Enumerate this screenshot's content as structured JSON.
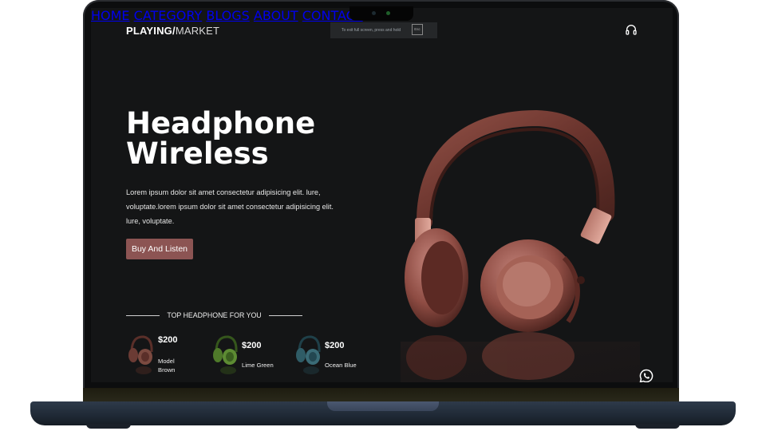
{
  "brand": {
    "logo_bold": "PLAYING/",
    "logo_light": "MARKET"
  },
  "nav": {
    "items": [
      {
        "label": "HOME"
      },
      {
        "label": "CATEGORY"
      },
      {
        "label": "BLOGS"
      },
      {
        "label": "ABOUT"
      },
      {
        "label": "CONTACT"
      }
    ],
    "support_icon": "headphones-icon"
  },
  "fullscreen_notice": {
    "text": "To exit full screen, press and hold",
    "key": "Esc"
  },
  "hero": {
    "title_line1": "Headphone",
    "title_line2": "Wireless",
    "description": "Lorem ipsum dolor sit amet consectetur adipisicing elit. lure, voluptate.lorem ipsum dolor sit amet consectetur adipisicing elit. lure, voluptate.",
    "cta_label": "Buy And Listen",
    "image": "rose-gold-headphones"
  },
  "top_section": {
    "heading": "TOP HEADPHONE FOR YOU",
    "products": [
      {
        "price": "$200",
        "name": "Model Brown",
        "color": "#6b3b34"
      },
      {
        "price": "$200",
        "name": "Lime Green",
        "color": "#4f7a2a"
      },
      {
        "price": "$200",
        "name": "Ocean Blue",
        "color": "#2f5c66"
      }
    ]
  },
  "floating": {
    "chat_icon": "whatsapp-icon"
  },
  "colors": {
    "background": "#141516",
    "accent": "#8c5453",
    "text": "#ffffff"
  }
}
